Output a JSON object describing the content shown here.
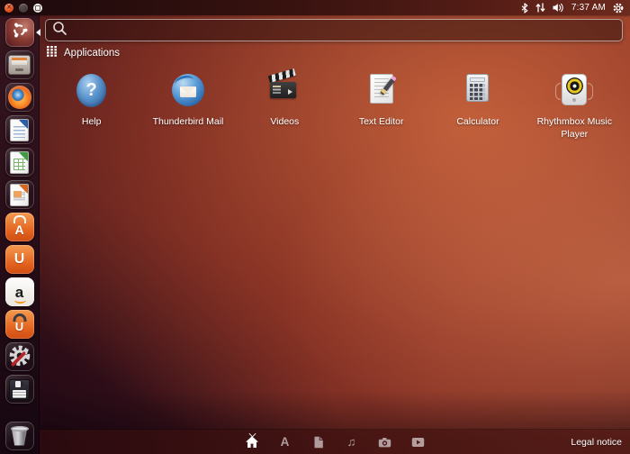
{
  "panel": {
    "time": "7:37 AM"
  },
  "search": {
    "value": ""
  },
  "header": {
    "category_label": "Applications"
  },
  "apps": [
    {
      "label": "Help",
      "glyph": "?"
    },
    {
      "label": "Thunderbird Mail"
    },
    {
      "label": "Videos"
    },
    {
      "label": "Text Editor"
    },
    {
      "label": "Calculator"
    },
    {
      "label": "Rhythmbox Music Player"
    }
  ],
  "launcher": {
    "items": [
      {
        "name": "dash-home"
      },
      {
        "name": "files"
      },
      {
        "name": "firefox"
      },
      {
        "name": "libreoffice-writer"
      },
      {
        "name": "libreoffice-calc"
      },
      {
        "name": "libreoffice-impress"
      },
      {
        "name": "ubuntu-software-center",
        "glyph": "A"
      },
      {
        "name": "ubuntu-one",
        "glyph": "U"
      },
      {
        "name": "amazon",
        "glyph": "a"
      },
      {
        "name": "ubuntu-one-music",
        "glyph": "U"
      },
      {
        "name": "system-settings"
      },
      {
        "name": "disk"
      },
      {
        "name": "trash"
      }
    ]
  },
  "lens_bar": {
    "app_lens_glyph": "A",
    "music_lens_glyph": "♫",
    "legal_label": "Legal notice"
  },
  "colors": {
    "ubuntu_orange": "#dd4814",
    "dash_maroon": "#571c1c",
    "text": "#ffffff"
  }
}
